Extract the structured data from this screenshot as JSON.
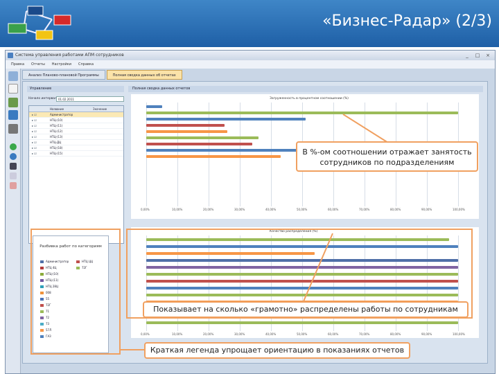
{
  "slide": {
    "title": "«Бизнес-Радар» (2/3)"
  },
  "app": {
    "window_title": "Система управления работами АПМ сотрудников",
    "window_controls": [
      "_",
      "□",
      "×"
    ],
    "menu": [
      "Правка",
      "Отчеты",
      "Настройки",
      "Справка"
    ],
    "tabs": [
      "Анализ Планово-плановой Программы",
      "Полная сводка данных об отчетах"
    ]
  },
  "left_panel": {
    "header": "Управление",
    "filter_label": "Начало интервала",
    "filter_value": "01.02.2011",
    "grid_columns": [
      "Название",
      "Значение"
    ],
    "rows": [
      {
        "name": "Администратор",
        "selected": true
      },
      {
        "name": "НТЦ-(10)",
        "selected": false
      },
      {
        "name": "НТЦ-(11)",
        "selected": false
      },
      {
        "name": "НТЦ-(12)",
        "selected": false
      },
      {
        "name": "НТЦ-(13)",
        "selected": false
      },
      {
        "name": "НТЦ-ДЦ",
        "selected": false
      },
      {
        "name": "НТЦ-(18)",
        "selected": false
      },
      {
        "name": "НТЦ-(15)",
        "selected": false
      }
    ]
  },
  "legend": {
    "title": "Разбивка работ по категориям",
    "items": [
      {
        "label": "Администратор",
        "color": "#4f6fa8"
      },
      {
        "label": "НТЦ 4Ц",
        "color": "#b23b3b"
      },
      {
        "label": "НТЦ-(10)",
        "color": "#8bab3c"
      },
      {
        "label": "НТЦ-(11)",
        "color": "#7056a0"
      },
      {
        "label": "НТЦ 28Ц",
        "color": "#2e9fb8"
      },
      {
        "label": "008",
        "color": "#f0923b"
      },
      {
        "label": "55",
        "color": "#4a72b8"
      },
      {
        "label": "72Г",
        "color": "#c0504d"
      },
      {
        "label": "71",
        "color": "#9bbb59"
      },
      {
        "label": "72",
        "color": "#8064a2"
      },
      {
        "label": "73",
        "color": "#4bacc6"
      },
      {
        "label": "57Л",
        "color": "#f79646"
      },
      {
        "label": "ГАЗ",
        "color": "#4f81bd"
      },
      {
        "label": "НТЦ ЦЦ",
        "color": "#c0504d"
      },
      {
        "label": "72Г",
        "color": "#9bbb59"
      }
    ]
  },
  "charts": {
    "top_header": "Полная сводка данных отчетов",
    "top_title": "Загруженность в процентном соотношении (%)",
    "top_ticks": [
      "0,00%",
      "10,00%",
      "20,00%",
      "30,00%",
      "40,00%",
      "50,00%",
      "60,00%",
      "70,00%",
      "80,00%",
      "90,00%",
      "100,00%"
    ],
    "bottom_title": "Качество распределения (%)",
    "bottom_ticks": [
      "0,00%",
      "10,00%",
      "20,00%",
      "30,00%",
      "40,00%",
      "50,00%",
      "60,00%",
      "70,00%",
      "80,00%",
      "90,00%",
      "100,00%"
    ]
  },
  "top_bars": [
    {
      "value": 5.0,
      "color": "#4f81bd"
    },
    {
      "value": 100.0,
      "color": "#9bbb59"
    },
    {
      "value": 51.0,
      "color": "#4f81bd"
    },
    {
      "value": 25.0,
      "color": "#c0504d"
    },
    {
      "value": 26.0,
      "color": "#f79646"
    },
    {
      "value": 36.0,
      "color": "#9bbb59"
    },
    {
      "value": 34.0,
      "color": "#c0504d"
    },
    {
      "value": 49.0,
      "color": "#4f81bd"
    },
    {
      "value": 43.0,
      "color": "#f79646"
    }
  ],
  "bottom_bars": [
    {
      "value": 97.0,
      "color": "#9bbb59"
    },
    {
      "value": 100.0,
      "color": "#4f81bd"
    },
    {
      "value": 54.0,
      "color": "#f79646"
    },
    {
      "value": 100.0,
      "color": "#4f6fa8"
    },
    {
      "value": 100.0,
      "color": "#8064a2"
    },
    {
      "value": 100.0,
      "color": "#9bbb59"
    },
    {
      "value": 100.0,
      "color": "#c0504d"
    },
    {
      "value": 100.0,
      "color": "#4f81bd"
    },
    {
      "value": 100.0,
      "color": "#9bbb59"
    },
    {
      "value": 100.0,
      "color": "#f79646"
    },
    {
      "value": 100.0,
      "color": "#4f81bd"
    },
    {
      "value": 100.0,
      "color": "#c0504d"
    },
    {
      "value": 100.0,
      "color": "#9bbb59"
    }
  ],
  "annotations": {
    "top": "В %-ом соотношении отражает занятость сотрудников по подразделениям",
    "middle": "Показывает на сколько «грамотно» распределены работы по сотрудникам",
    "bottom": "Краткая легенда упрощает ориентацию в показаниях отчетов"
  }
}
